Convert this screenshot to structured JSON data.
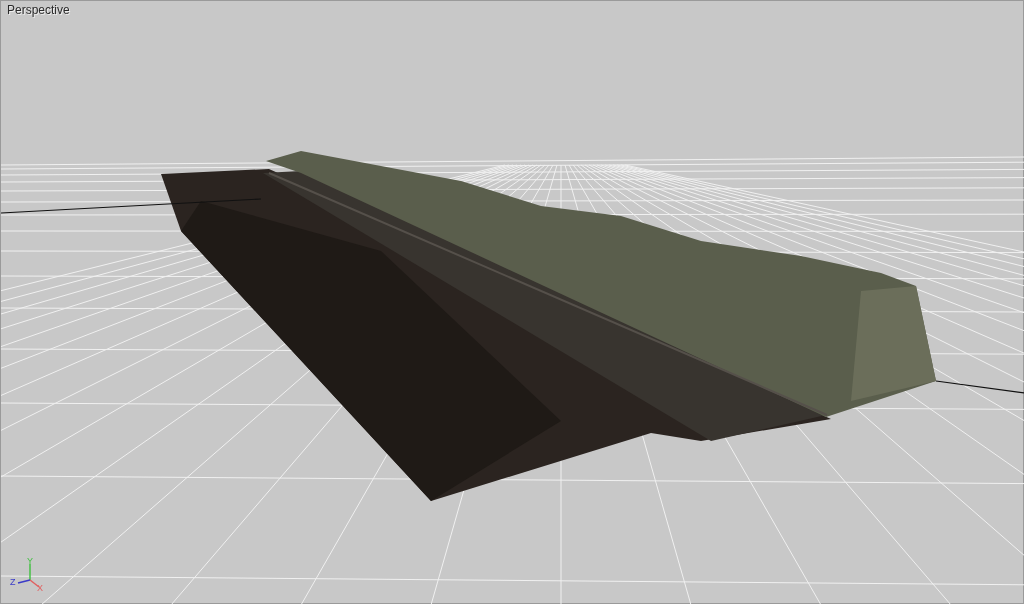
{
  "viewport": {
    "label": "Perspective",
    "axis_gizmo": {
      "y": "Y",
      "z": "Z",
      "x": "X"
    }
  }
}
